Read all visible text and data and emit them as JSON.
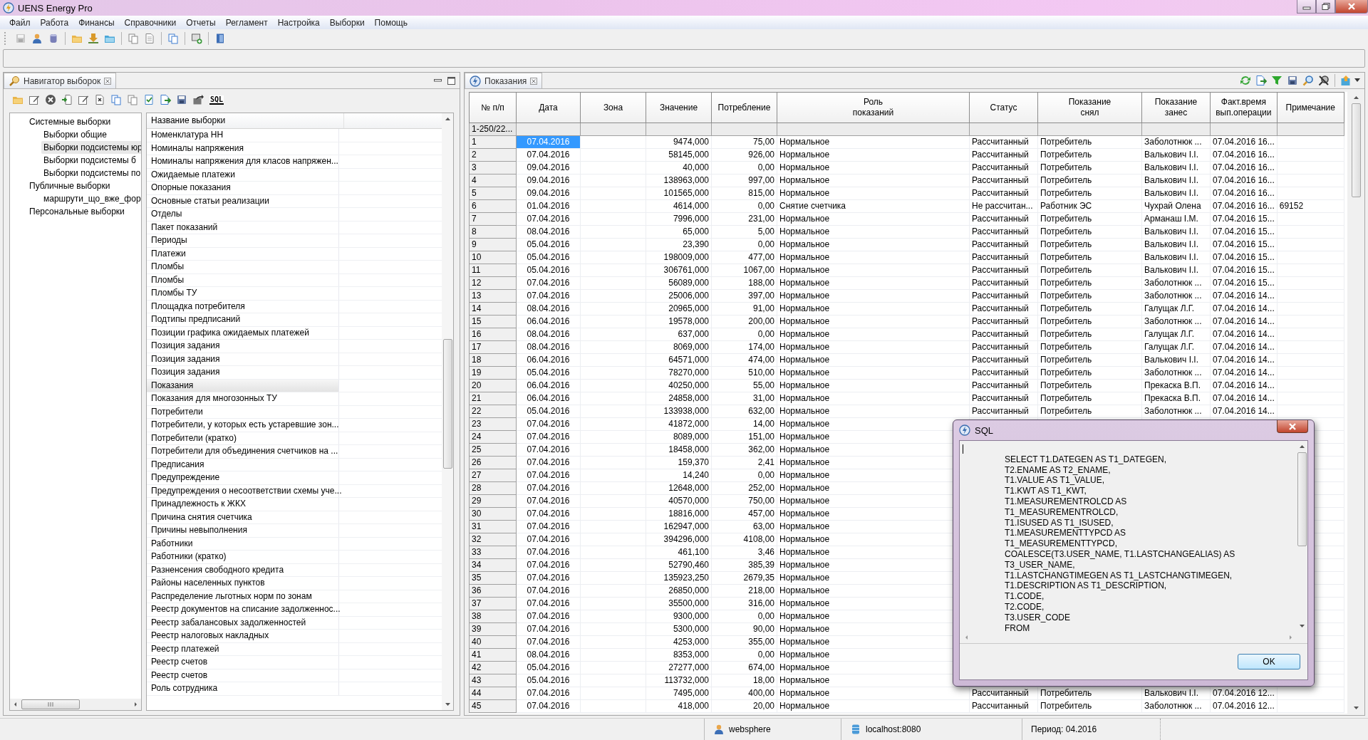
{
  "window": {
    "title": "UENS Energy Pro"
  },
  "menu": [
    "Файл",
    "Работа",
    "Финансы",
    "Справочники",
    "Отчеты",
    "Регламент",
    "Настройка",
    "Выборки",
    "Помощь"
  ],
  "navigator": {
    "tab": "Навигатор выборок",
    "sql_button": "SQL",
    "tree": [
      {
        "label": "Системные выборки",
        "selected": false,
        "children": [
          {
            "label": "Выборки общие",
            "selected": false
          },
          {
            "label": "Выборки подсистемы юр",
            "selected": true
          },
          {
            "label": "Выборки подсистемы б",
            "selected": false
          },
          {
            "label": "Выборки подсистемы по",
            "selected": false
          }
        ]
      },
      {
        "label": "Публичные выборки",
        "selected": false,
        "children": [
          {
            "label": "маршрути_що_вже_фор",
            "selected": false
          }
        ]
      },
      {
        "label": "Персональные выборки",
        "selected": false
      }
    ],
    "list_header": "Название выборки",
    "items": [
      {
        "label": "Номенклатура НН",
        "selected": false
      },
      {
        "label": "Номиналы напряжения",
        "selected": false
      },
      {
        "label": "Номиналы напряжения для класов напряжен...",
        "selected": false
      },
      {
        "label": "Ожидаемые платежи",
        "selected": false
      },
      {
        "label": "Опорные показания",
        "selected": false
      },
      {
        "label": "Основные статьи реализации",
        "selected": false
      },
      {
        "label": "Отделы",
        "selected": false
      },
      {
        "label": "Пакет показаний",
        "selected": false
      },
      {
        "label": "Периоды",
        "selected": false
      },
      {
        "label": "Платежи",
        "selected": false
      },
      {
        "label": "Пломбы",
        "selected": false
      },
      {
        "label": "Пломбы",
        "selected": false
      },
      {
        "label": "Пломбы ТУ",
        "selected": false
      },
      {
        "label": "Площадка потребителя",
        "selected": false
      },
      {
        "label": "Подтипы предписаний",
        "selected": false
      },
      {
        "label": "Позиции графика ожидаемых платежей",
        "selected": false
      },
      {
        "label": "Позиция задания",
        "selected": false
      },
      {
        "label": "Позиция задания",
        "selected": false
      },
      {
        "label": "Позиция задания",
        "selected": false
      },
      {
        "label": "Показания",
        "selected": true
      },
      {
        "label": "Показания для многозонных ТУ",
        "selected": false
      },
      {
        "label": "Потребители",
        "selected": false
      },
      {
        "label": "Потребители, у которых есть устаревшие зон...",
        "selected": false
      },
      {
        "label": "Потребители (кратко)",
        "selected": false
      },
      {
        "label": "Потребители для объединения счетчиков на ...",
        "selected": false
      },
      {
        "label": "Предписания",
        "selected": false
      },
      {
        "label": "Предупреждение",
        "selected": false
      },
      {
        "label": "Предупреждения о несоответствии схемы уче...",
        "selected": false
      },
      {
        "label": "Принадлежность к ЖКХ",
        "selected": false
      },
      {
        "label": "Причина снятия счетчика",
        "selected": false
      },
      {
        "label": "Причины невыполнения",
        "selected": false
      },
      {
        "label": "Работники",
        "selected": false
      },
      {
        "label": "Работники (кратко)",
        "selected": false
      },
      {
        "label": "Разненсения свободного кредита",
        "selected": false
      },
      {
        "label": "Районы населенных пунктов",
        "selected": false
      },
      {
        "label": "Распределение льготных норм по зонам",
        "selected": false
      },
      {
        "label": "Реестр документов на списание задолженнос...",
        "selected": false
      },
      {
        "label": "Реестр забалансовых задолженностей",
        "selected": false
      },
      {
        "label": "Реестр налоговых накладных",
        "selected": false
      },
      {
        "label": "Реестр платежей",
        "selected": false
      },
      {
        "label": "Реестр счетов",
        "selected": false
      },
      {
        "label": "Реестр счетов",
        "selected": false
      },
      {
        "label": "Роль сотрудника",
        "selected": false
      }
    ]
  },
  "readings": {
    "tab": "Показания",
    "columns": [
      "№ п/п",
      "Дата",
      "Зона",
      "Значение",
      "Потребление",
      "Роль\nпоказаний",
      "Статус",
      "Показание\nснял",
      "Показание\nзанес",
      "Факт.время\nвып.операции",
      "Примечание"
    ],
    "filter": "1-250/22...",
    "rows": [
      {
        "num": "1",
        "date": "07.04.2016",
        "value": "9474,000",
        "consumption": "75,00",
        "role": "Нормальное",
        "status": "Рассчитанный",
        "taken_by": "Потребитель",
        "entered_by": "Заболотнюк ...",
        "op_time": "07.04.2016 16...",
        "selected": true
      },
      {
        "num": "2",
        "date": "07.04.2016",
        "value": "58145,000",
        "consumption": "926,00",
        "role": "Нормальное",
        "status": "Рассчитанный",
        "taken_by": "Потребитель",
        "entered_by": "Валькович І.І.",
        "op_time": "07.04.2016 16...",
        "selected": false
      },
      {
        "num": "3",
        "date": "09.04.2016",
        "value": "40,000",
        "consumption": "0,00",
        "role": "Нормальное",
        "status": "Рассчитанный",
        "taken_by": "Потребитель",
        "entered_by": "Валькович І.І.",
        "op_time": "07.04.2016 16...",
        "selected": false
      },
      {
        "num": "4",
        "date": "09.04.2016",
        "value": "138963,000",
        "consumption": "997,00",
        "role": "Нормальное",
        "status": "Рассчитанный",
        "taken_by": "Потребитель",
        "entered_by": "Валькович І.І.",
        "op_time": "07.04.2016 16...",
        "selected": false
      },
      {
        "num": "5",
        "date": "09.04.2016",
        "value": "101565,000",
        "consumption": "815,00",
        "role": "Нормальное",
        "status": "Рассчитанный",
        "taken_by": "Потребитель",
        "entered_by": "Валькович І.І.",
        "op_time": "07.04.2016 16...",
        "selected": false
      },
      {
        "num": "6",
        "date": "01.04.2016",
        "value": "4614,000",
        "consumption": "0,00",
        "role": "Снятие счетчика",
        "status": "Не рассчитан...",
        "taken_by": "Работник ЭС",
        "entered_by": "Чухрай Олена",
        "op_time": "07.04.2016 16...",
        "note": "69152",
        "selected": false
      },
      {
        "num": "7",
        "date": "07.04.2016",
        "value": "7996,000",
        "consumption": "231,00",
        "role": "Нормальное",
        "status": "Рассчитанный",
        "taken_by": "Потребитель",
        "entered_by": "Арманаш І.М.",
        "op_time": "07.04.2016 15...",
        "selected": false
      },
      {
        "num": "8",
        "date": "08.04.2016",
        "value": "65,000",
        "consumption": "5,00",
        "role": "Нормальное",
        "status": "Рассчитанный",
        "taken_by": "Потребитель",
        "entered_by": "Валькович І.І.",
        "op_time": "07.04.2016 15...",
        "selected": false
      },
      {
        "num": "9",
        "date": "05.04.2016",
        "value": "23,390",
        "consumption": "0,00",
        "role": "Нормальное",
        "status": "Рассчитанный",
        "taken_by": "Потребитель",
        "entered_by": "Валькович І.І.",
        "op_time": "07.04.2016 15...",
        "selected": false
      },
      {
        "num": "10",
        "date": "05.04.2016",
        "value": "198009,000",
        "consumption": "477,00",
        "role": "Нормальное",
        "status": "Рассчитанный",
        "taken_by": "Потребитель",
        "entered_by": "Валькович І.І.",
        "op_time": "07.04.2016 15...",
        "selected": false
      },
      {
        "num": "11",
        "date": "05.04.2016",
        "value": "306761,000",
        "consumption": "1067,00",
        "role": "Нормальное",
        "status": "Рассчитанный",
        "taken_by": "Потребитель",
        "entered_by": "Валькович І.І.",
        "op_time": "07.04.2016 15...",
        "selected": false
      },
      {
        "num": "12",
        "date": "07.04.2016",
        "value": "56089,000",
        "consumption": "188,00",
        "role": "Нормальное",
        "status": "Рассчитанный",
        "taken_by": "Потребитель",
        "entered_by": "Заболотнюк ...",
        "op_time": "07.04.2016 15...",
        "selected": false
      },
      {
        "num": "13",
        "date": "07.04.2016",
        "value": "25006,000",
        "consumption": "397,00",
        "role": "Нормальное",
        "status": "Рассчитанный",
        "taken_by": "Потребитель",
        "entered_by": "Заболотнюк ...",
        "op_time": "07.04.2016 14...",
        "selected": false
      },
      {
        "num": "14",
        "date": "08.04.2016",
        "value": "20965,000",
        "consumption": "91,00",
        "role": "Нормальное",
        "status": "Рассчитанный",
        "taken_by": "Потребитель",
        "entered_by": "Галущак Л.Г.",
        "op_time": "07.04.2016 14...",
        "selected": false
      },
      {
        "num": "15",
        "date": "06.04.2016",
        "value": "19578,000",
        "consumption": "200,00",
        "role": "Нормальное",
        "status": "Рассчитанный",
        "taken_by": "Потребитель",
        "entered_by": "Заболотнюк ...",
        "op_time": "07.04.2016 14...",
        "selected": false
      },
      {
        "num": "16",
        "date": "08.04.2016",
        "value": "637,000",
        "consumption": "0,00",
        "role": "Нормальное",
        "status": "Рассчитанный",
        "taken_by": "Потребитель",
        "entered_by": "Галущак Л.Г.",
        "op_time": "07.04.2016 14...",
        "selected": false
      },
      {
        "num": "17",
        "date": "08.04.2016",
        "value": "8069,000",
        "consumption": "174,00",
        "role": "Нормальное",
        "status": "Рассчитанный",
        "taken_by": "Потребитель",
        "entered_by": "Галущак Л.Г.",
        "op_time": "07.04.2016 14...",
        "selected": false
      },
      {
        "num": "18",
        "date": "06.04.2016",
        "value": "64571,000",
        "consumption": "474,00",
        "role": "Нормальное",
        "status": "Рассчитанный",
        "taken_by": "Потребитель",
        "entered_by": "Валькович І.І.",
        "op_time": "07.04.2016 14...",
        "selected": false
      },
      {
        "num": "19",
        "date": "05.04.2016",
        "value": "78270,000",
        "consumption": "510,00",
        "role": "Нормальное",
        "status": "Рассчитанный",
        "taken_by": "Потребитель",
        "entered_by": "Заболотнюк ...",
        "op_time": "07.04.2016 14...",
        "selected": false
      },
      {
        "num": "20",
        "date": "06.04.2016",
        "value": "40250,000",
        "consumption": "55,00",
        "role": "Нормальное",
        "status": "Рассчитанный",
        "taken_by": "Потребитель",
        "entered_by": "Прекаска В.П.",
        "op_time": "07.04.2016 14...",
        "selected": false
      },
      {
        "num": "21",
        "date": "06.04.2016",
        "value": "24858,000",
        "consumption": "31,00",
        "role": "Нормальное",
        "status": "Рассчитанный",
        "taken_by": "Потребитель",
        "entered_by": "Прекаска В.П.",
        "op_time": "07.04.2016 14...",
        "selected": false
      },
      {
        "num": "22",
        "date": "05.04.2016",
        "value": "133938,000",
        "consumption": "632,00",
        "role": "Нормальное",
        "status": "Рассчитанный",
        "taken_by": "Потребитель",
        "entered_by": "Заболотнюк ...",
        "op_time": "07.04.2016 14...",
        "selected": false
      },
      {
        "num": "23",
        "date": "07.04.2016",
        "value": "41872,000",
        "consumption": "14,00",
        "role": "Нормальное",
        "selected": false
      },
      {
        "num": "24",
        "date": "07.04.2016",
        "value": "8089,000",
        "consumption": "151,00",
        "role": "Нормальное",
        "selected": false
      },
      {
        "num": "25",
        "date": "07.04.2016",
        "value": "18458,000",
        "consumption": "362,00",
        "role": "Нормальное",
        "selected": false
      },
      {
        "num": "26",
        "date": "07.04.2016",
        "value": "159,370",
        "consumption": "2,41",
        "role": "Нормальное",
        "selected": false
      },
      {
        "num": "27",
        "date": "07.04.2016",
        "value": "14,240",
        "consumption": "0,00",
        "role": "Нормальное",
        "selected": false
      },
      {
        "num": "28",
        "date": "07.04.2016",
        "value": "12648,000",
        "consumption": "252,00",
        "role": "Нормальное",
        "selected": false
      },
      {
        "num": "29",
        "date": "07.04.2016",
        "value": "40570,000",
        "consumption": "750,00",
        "role": "Нормальное",
        "selected": false
      },
      {
        "num": "30",
        "date": "07.04.2016",
        "value": "18816,000",
        "consumption": "457,00",
        "role": "Нормальное",
        "selected": false
      },
      {
        "num": "31",
        "date": "07.04.2016",
        "value": "162947,000",
        "consumption": "63,00",
        "role": "Нормальное",
        "selected": false
      },
      {
        "num": "32",
        "date": "07.04.2016",
        "value": "394296,000",
        "consumption": "4108,00",
        "role": "Нормальное",
        "selected": false
      },
      {
        "num": "33",
        "date": "07.04.2016",
        "value": "461,100",
        "consumption": "3,46",
        "role": "Нормальное",
        "selected": false
      },
      {
        "num": "34",
        "date": "07.04.2016",
        "value": "52790,460",
        "consumption": "385,39",
        "role": "Нормальное",
        "selected": false
      },
      {
        "num": "35",
        "date": "07.04.2016",
        "value": "135923,250",
        "consumption": "2679,35",
        "role": "Нормальное",
        "selected": false
      },
      {
        "num": "36",
        "date": "07.04.2016",
        "value": "26850,000",
        "consumption": "218,00",
        "role": "Нормальное",
        "selected": false
      },
      {
        "num": "37",
        "date": "07.04.2016",
        "value": "35500,000",
        "consumption": "316,00",
        "role": "Нормальное",
        "selected": false
      },
      {
        "num": "38",
        "date": "07.04.2016",
        "value": "9300,000",
        "consumption": "0,00",
        "role": "Нормальное",
        "selected": false
      },
      {
        "num": "39",
        "date": "07.04.2016",
        "value": "5300,000",
        "consumption": "90,00",
        "role": "Нормальное",
        "selected": false
      },
      {
        "num": "40",
        "date": "07.04.2016",
        "value": "4253,000",
        "consumption": "355,00",
        "role": "Нормальное",
        "selected": false
      },
      {
        "num": "41",
        "date": "08.04.2016",
        "value": "8353,000",
        "consumption": "0,00",
        "role": "Нормальное",
        "selected": false
      },
      {
        "num": "42",
        "date": "05.04.2016",
        "value": "27277,000",
        "consumption": "674,00",
        "role": "Нормальное",
        "selected": false
      },
      {
        "num": "43",
        "date": "05.04.2016",
        "value": "113732,000",
        "consumption": "18,00",
        "role": "Нормальное",
        "selected": false
      },
      {
        "num": "44",
        "date": "07.04.2016",
        "value": "7495,000",
        "consumption": "400,00",
        "role": "Нормальное",
        "status": "Рассчитанный",
        "taken_by": "Потребитель",
        "entered_by": "Валькович І.І.",
        "op_time": "07.04.2016 12...",
        "selected": false
      },
      {
        "num": "45",
        "date": "07.04.2016",
        "value": "418,000",
        "consumption": "20,00",
        "role": "Нормальное",
        "status": "Рассчитанный",
        "taken_by": "Потребитель",
        "entered_by": "Заболотнюк ...",
        "op_time": "07.04.2016 12...",
        "selected": false
      }
    ]
  },
  "sql_dialog": {
    "title": "SQL",
    "text": "SELECT T1.DATEGEN AS T1_DATEGEN,\nT2.ENAME AS T2_ENAME,\nT1.VALUE AS T1_VALUE,\nT1.KWT AS T1_KWT,\nT1.MEASUREMENTROLCD AS\nT1_MEASUREMENTROLCD,\nT1.ISUSED AS T1_ISUSED,\nT1.MEASUREMENTTYPCD AS\nT1_MEASUREMENTTYPCD,\nCOALESCE(T3.USER_NAME, T1.LASTCHANGEALIAS) AS\nT3_USER_NAME,\nT1.LASTCHANGTIMEGEN AS T1_LASTCHANGTIMEGEN,\nT1.DESCRIPTION AS T1_DESCRIPTION,\nT1.CODE,\nT2.CODE,\nT3.USER_CODE\nFROM",
    "ok": "OK"
  },
  "status_bar": {
    "user": "websphere",
    "server": "localhost:8080",
    "period": "Период: 04.2016"
  }
}
